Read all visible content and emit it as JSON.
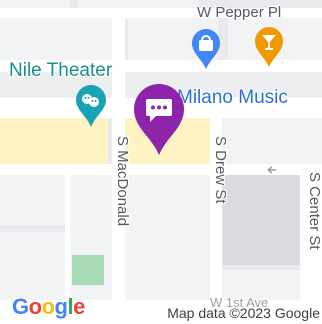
{
  "map": {
    "streets": {
      "w_pepper_pl": "W Pepper Pl",
      "s_macdonald": "S MacDonald",
      "s_drew_st": "S Drew St",
      "s_center_st": "S Center St",
      "w_1st_ave": "W 1st Ave"
    },
    "places": {
      "nile_theater": "Nile Theater",
      "milano_music": "Milano Music"
    },
    "attribution": "Map data ©2023 Google",
    "logo_letters": [
      "G",
      "o",
      "o",
      "g",
      "l",
      "e"
    ],
    "colors": {
      "selected_marker": "#8e24aa",
      "theater_marker": "#1aa3b5",
      "shopping_marker": "#4285f4",
      "bar_marker": "#f29900"
    },
    "icons": {
      "selected": "chat-bubble-icon",
      "theater": "theater-masks-icon",
      "shopping": "shopping-bag-icon",
      "bar": "cocktail-glass-icon"
    }
  }
}
